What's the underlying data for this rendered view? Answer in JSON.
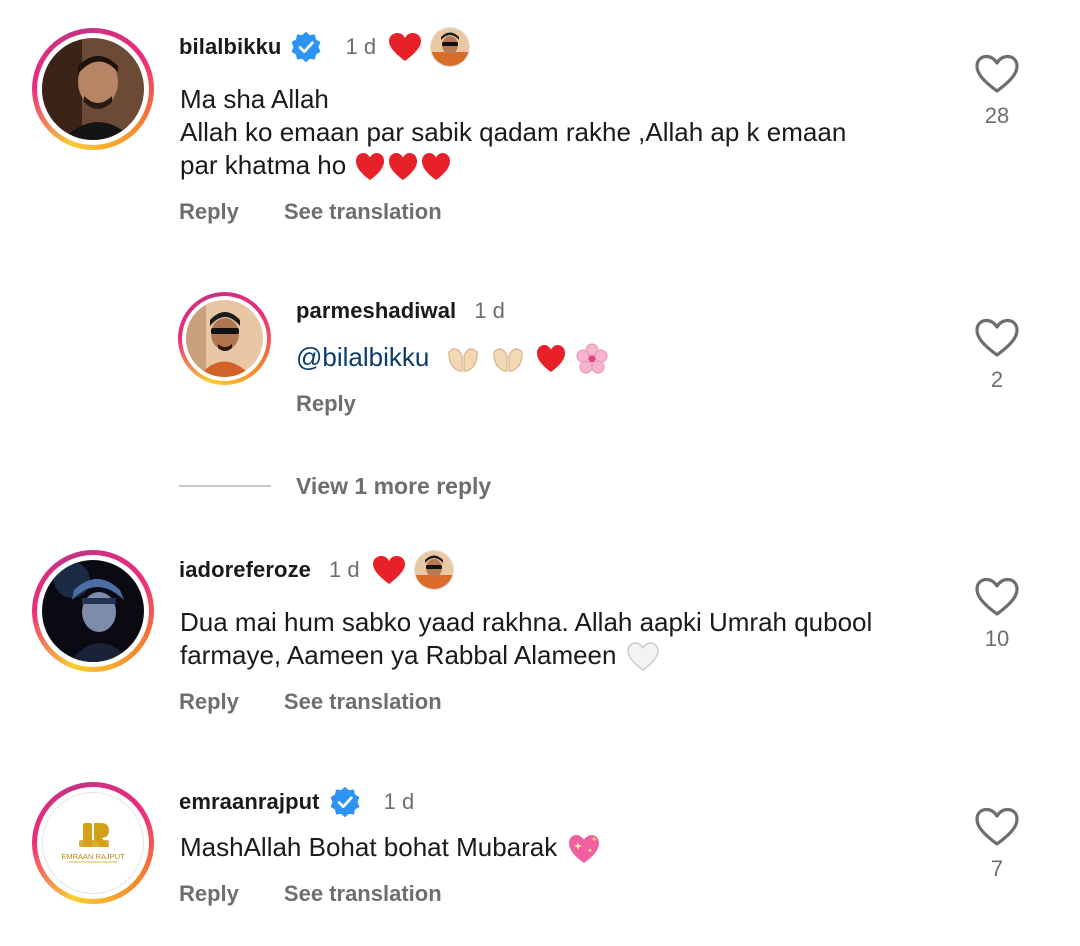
{
  "comments": [
    {
      "username": "bilalbikku",
      "verified": true,
      "time": "1 d",
      "text_lines": [
        "Ma sha Allah",
        "Allah ko emaan par sabik qadam rakhe ,Allah ap k  emaan",
        "par khatma ho"
      ],
      "reply_label": "Reply",
      "translate_label": "See translation",
      "likes": "28",
      "avatar_icon": "profile-photo"
    },
    {
      "username": "parmeshadiwal",
      "verified": false,
      "time": "1 d",
      "mention": "@bilalbikku",
      "reply_label": "Reply",
      "likes": "2",
      "avatar_icon": "profile-photo"
    },
    {
      "username": "iadoreferoze",
      "verified": false,
      "time": "1 d",
      "text_lines": [
        "Dua mai hum sabko yaad rakhna. Allah aapki Umrah qubool",
        "farmaye, Aameen ya Rabbal Alameen"
      ],
      "reply_label": "Reply",
      "translate_label": "See translation",
      "likes": "10",
      "avatar_icon": "profile-photo"
    },
    {
      "username": "emraanrajput",
      "verified": true,
      "time": "1 d",
      "text_lines": [
        "MashAllah Bohat bohat Mubarak"
      ],
      "reply_label": "Reply",
      "translate_label": "See translation",
      "likes": "7",
      "avatar_logo_text": "EMRAAN RAJPUT"
    }
  ],
  "view_more_label": "View 1 more reply",
  "colors": {
    "red_heart": "#e8202a",
    "verified_blue": "#2d94f4",
    "muted": "#6e6e6e"
  }
}
